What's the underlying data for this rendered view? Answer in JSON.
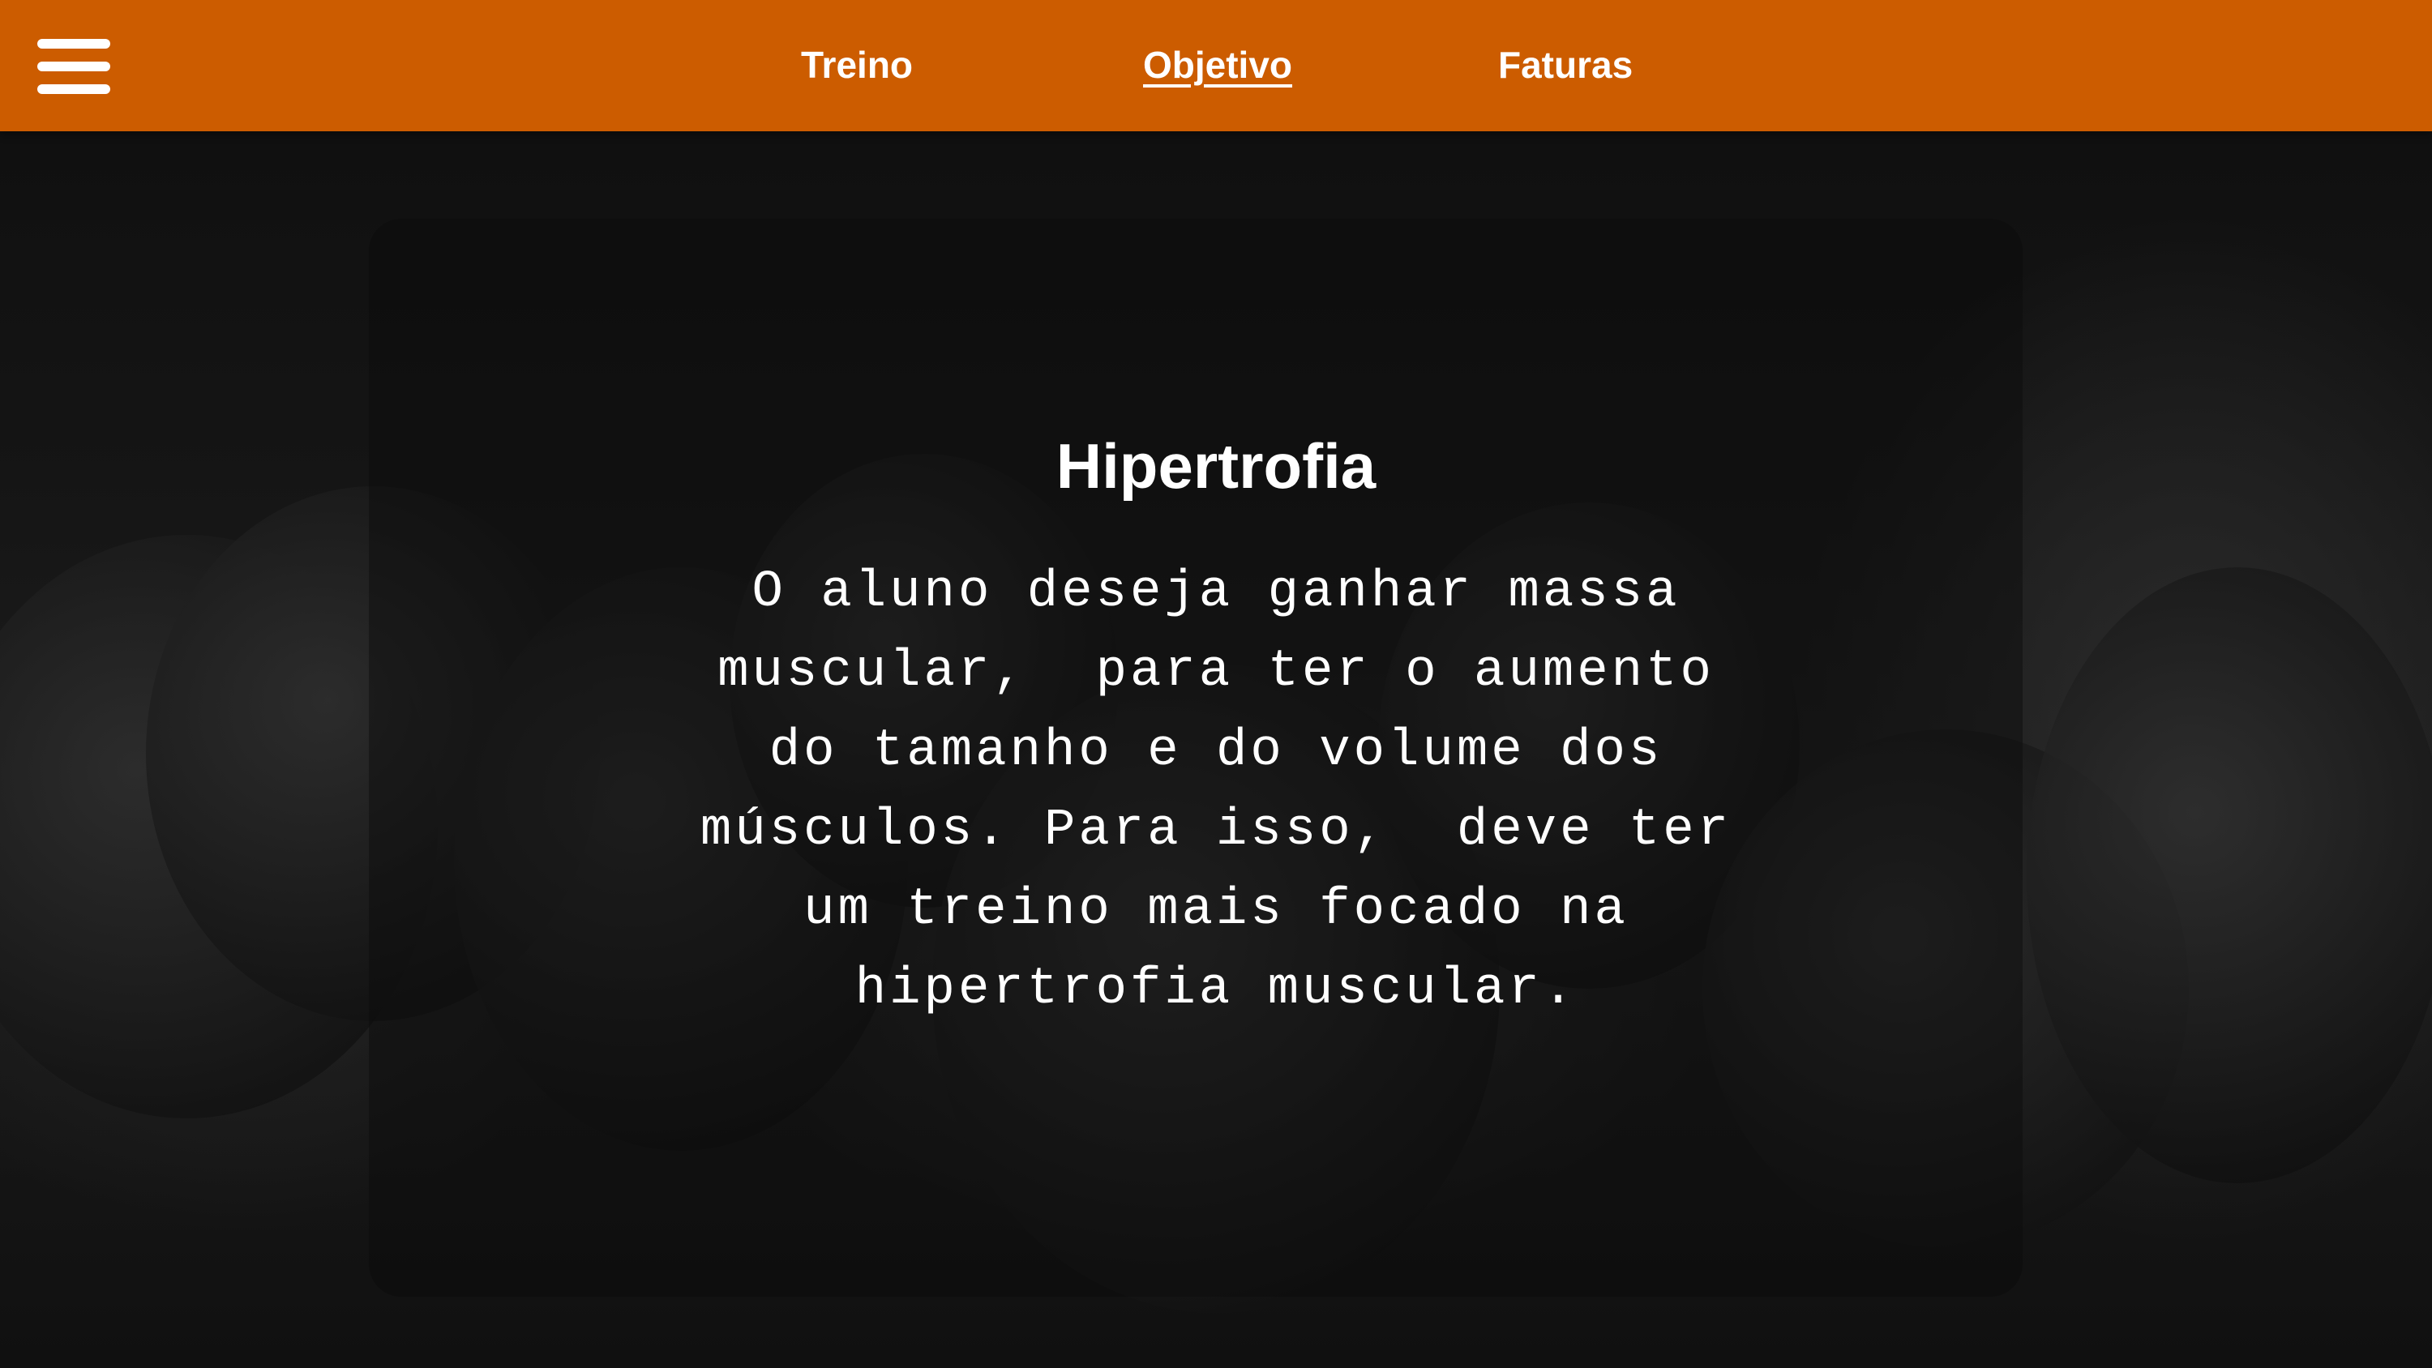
{
  "header": {
    "menu_icon": "hamburger-menu-icon",
    "background_color": "#cc5c00",
    "nav": [
      {
        "label": "Treino",
        "active": false
      },
      {
        "label": "Objetivo",
        "active": true
      },
      {
        "label": "Faturas",
        "active": false
      }
    ]
  },
  "main": {
    "title": "Hipertrofia",
    "description": "O aluno deseja ganhar massa\nmuscular,  para ter o aumento\ndo tamanho e do volume dos\nmúsculos. Para isso,  deve ter\num treino mais focado na\nhipertrofia muscular."
  }
}
